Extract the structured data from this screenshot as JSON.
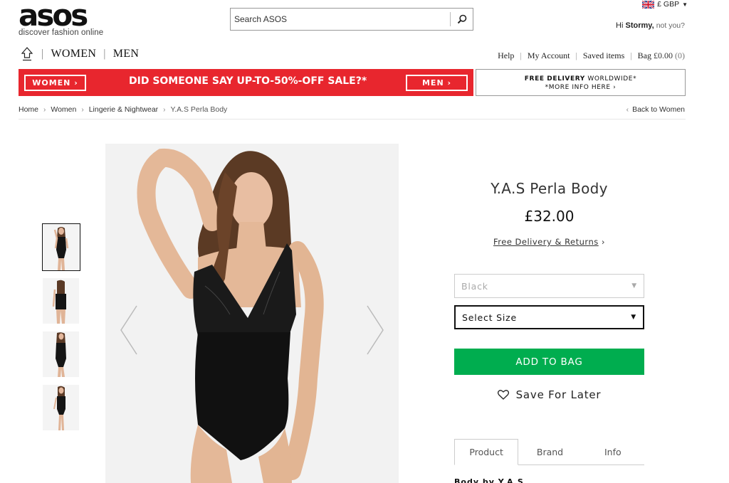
{
  "header": {
    "logo_text": "asos",
    "logo_tagline": "discover fashion online",
    "search_placeholder": "Search ASOS",
    "currency": "£ GBP",
    "greeting_prefix": "Hi",
    "greeting_name": "Stormy,",
    "greeting_suffix": "not you?"
  },
  "nav": {
    "women": "WOMEN",
    "men": "MEN"
  },
  "util_links": {
    "help": "Help",
    "account": "My Account",
    "saved": "Saved items",
    "bag_label": "Bag",
    "bag_amount": "£0.00",
    "bag_count": "(0)"
  },
  "sale_banner": {
    "women_btn": "WOMEN ›",
    "text": "DID SOMEONE SAY UP-TO-50%-OFF SALE?*",
    "men_btn": "MEN ›",
    "bg_color": "#e8262e"
  },
  "delivery_banner": {
    "bold": "FREE DELIVERY",
    "rest": "WORLDWIDE*",
    "line2": "*MORE INFO HERE ›"
  },
  "breadcrumb": [
    "Home",
    "Women",
    "Lingerie & Nightwear",
    "Y.A.S Perla Body"
  ],
  "back_link": "Back to Women",
  "product": {
    "title": "Y.A.S Perla Body",
    "price": "£32.00",
    "free_delivery": "Free Delivery & Returns",
    "colour_value": "Black",
    "size_value": "Select Size",
    "add_to_bag": "ADD TO BAG",
    "save_for_later": "Save For Later",
    "add_btn_color": "#00ad4f"
  },
  "tabs": [
    "Product",
    "Brand",
    "Info"
  ],
  "partial_text": "Body by Y.A.S"
}
